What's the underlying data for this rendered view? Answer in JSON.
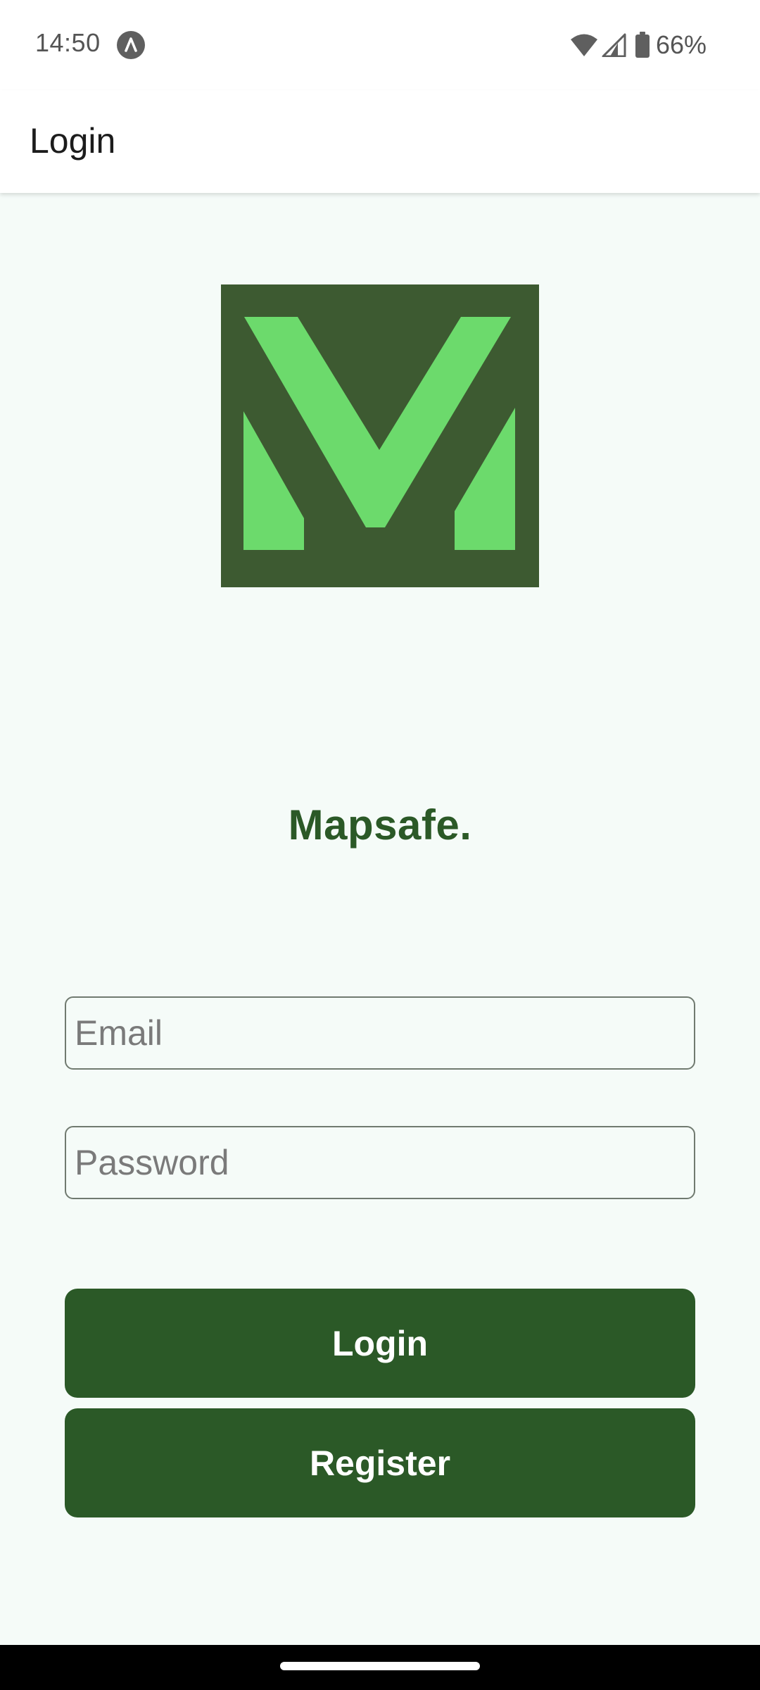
{
  "status_bar": {
    "time": "14:50",
    "app_icon": "android-studio-icon",
    "wifi_icon": "wifi-icon",
    "signal_icon": "cell-signal-icon",
    "battery_icon": "battery-icon",
    "battery_percent": "66%"
  },
  "app_bar": {
    "title": "Login"
  },
  "brand": {
    "logo_icon": "mapsafe-m-logo",
    "name": "Mapsafe.",
    "colors": {
      "primary": "#2b5927",
      "logo_bg": "#3d5a31",
      "logo_fg": "#6cda6c",
      "background": "#f5fbf8"
    }
  },
  "form": {
    "email_placeholder": "Email",
    "email_value": "",
    "password_placeholder": "Password",
    "password_value": ""
  },
  "actions": {
    "login_label": "Login",
    "register_label": "Register"
  }
}
